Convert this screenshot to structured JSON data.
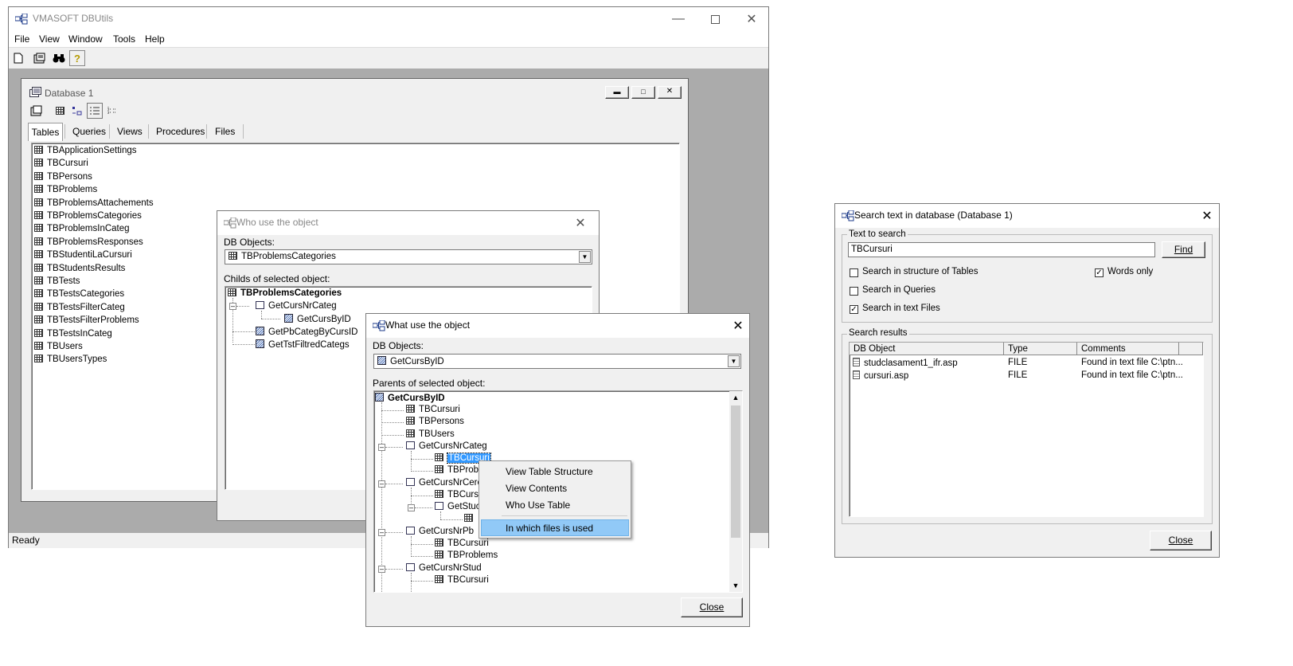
{
  "app": {
    "title": "VMASOFT DBUtils",
    "menu": [
      "File",
      "View",
      "Window",
      "Tools",
      "Help"
    ],
    "status": "Ready"
  },
  "db_window": {
    "title": "Database 1",
    "tabs": [
      "Tables",
      "Queries",
      "Views",
      "Procedures",
      "Files"
    ],
    "tables": [
      "TBApplicationSettings",
      "TBCursuri",
      "TBPersons",
      "TBProblems",
      "TBProblemsAttachements",
      "TBProblemsCategories",
      "TBProblemsInCateg",
      "TBProblemsResponses",
      "TBStudentiLaCursuri",
      "TBStudentsResults",
      "TBTests",
      "TBTestsCategories",
      "TBTestsFilterCateg",
      "TBTestsFilterProblems",
      "TBTestsInCateg",
      "TBUsers",
      "TBUsersTypes"
    ]
  },
  "who_use": {
    "title": "Who use the object",
    "db_objects_label": "DB Objects:",
    "selected": "TBProblemsCategories",
    "childs_label": "Childs of selected object:",
    "tree": {
      "root": "TBProblemsCategories",
      "n1": "GetCursNrCateg",
      "n1a": "GetCursByID",
      "n2": "GetPbCategByCursID",
      "n3": "GetTstFiltredCategs"
    }
  },
  "what_use": {
    "title": "What use the object",
    "db_objects_label": "DB Objects:",
    "selected": "GetCursByID",
    "parents_label": "Parents of selected object:",
    "tree": {
      "root": "GetCursByID",
      "r1": "TBCursuri",
      "r2": "TBPersons",
      "r3": "TBUsers",
      "r4": "GetCursNrCateg",
      "r5": "TBCursuri",
      "r6": "TBProbl",
      "r7": "GetCursNrCereri",
      "r8": "TBCursu",
      "r9": "GetStuc",
      "r10": "",
      "r11": "GetCursNrPb",
      "r12": "TBCursuri",
      "r13": "TBProblems",
      "r14": "GetCursNrStud",
      "r15": "TBCursuri"
    },
    "close_label": "Close"
  },
  "context_menu": {
    "items": [
      "View Table Structure",
      "View Contents",
      "Who Use Table",
      "In which files is used"
    ]
  },
  "search": {
    "title": "Search text in database (Database 1)",
    "text_group_label": "Text to search",
    "text_value": "TBCursuri",
    "find_label": "Find",
    "opt_structure": "Search in structure of Tables",
    "opt_queries": "Search in Queries",
    "opt_files": "Search in text Files",
    "opt_words": "Words only",
    "results_label": "Search results",
    "columns": [
      "DB Object",
      "Type",
      "Comments"
    ],
    "results": [
      {
        "object": "studclasament1_ifr.asp",
        "type": "FILE",
        "comment": "Found in text file C:\\ptn..."
      },
      {
        "object": "cursuri.asp",
        "type": "FILE",
        "comment": "Found in text file C:\\ptn..."
      }
    ],
    "close_label": "Close"
  }
}
